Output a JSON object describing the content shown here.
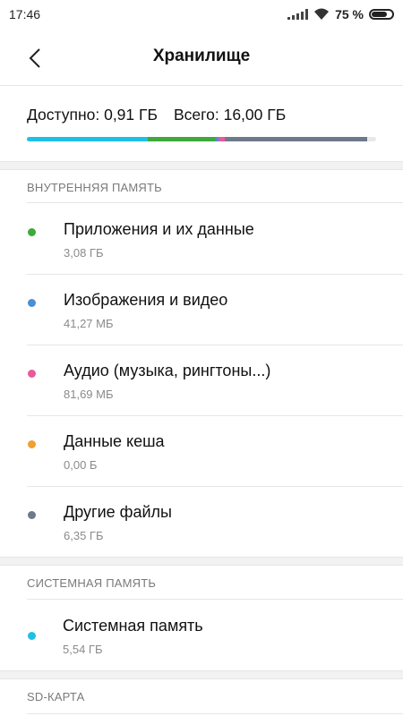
{
  "status_bar": {
    "time": "17:46",
    "battery_percent": "75 %",
    "icons": [
      "signal-icon",
      "wifi-icon",
      "battery-icon"
    ]
  },
  "header": {
    "title": "Хранилище",
    "back_icon": "chevron-left-icon"
  },
  "summary": {
    "available": "Доступно: 0,91 ГБ",
    "total": "Всего: 16,00 ГБ",
    "bar_segments": [
      {
        "name": "system",
        "fraction": 0.345,
        "color": "#1EC1E6"
      },
      {
        "name": "apps",
        "fraction": 0.193,
        "color": "#3DAA3A"
      },
      {
        "name": "images",
        "fraction": 0.012,
        "color": "#4B8ED6"
      },
      {
        "name": "audio",
        "fraction": 0.016,
        "color": "#E85A9A"
      },
      {
        "name": "cache",
        "fraction": 0.002,
        "color": "#F0A030"
      },
      {
        "name": "other",
        "fraction": 0.406,
        "color": "#6E7A8C"
      }
    ],
    "bar_track_color": "#E8E8E8"
  },
  "internal": {
    "title": "ВНУТРЕННЯЯ ПАМЯТЬ",
    "items": [
      {
        "label": "Приложения и их данные",
        "size": "3,08 ГБ",
        "color": "#3DAA3A"
      },
      {
        "label": "Изображения и видео",
        "size": "41,27 МБ",
        "color": "#4B8ED6"
      },
      {
        "label": "Аудио (музыка, рингтоны...)",
        "size": "81,69 МБ",
        "color": "#E85A9A"
      },
      {
        "label": "Данные кеша",
        "size": "0,00 Б",
        "color": "#F0A030"
      },
      {
        "label": "Другие файлы",
        "size": "6,35 ГБ",
        "color": "#6E7A8C"
      }
    ]
  },
  "system": {
    "title": "СИСТЕМНАЯ ПАМЯТЬ",
    "items": [
      {
        "label": "Системная память",
        "size": "5,54 ГБ",
        "color": "#1EC1E6"
      }
    ]
  },
  "sd": {
    "title": "SD-КАРТА"
  }
}
